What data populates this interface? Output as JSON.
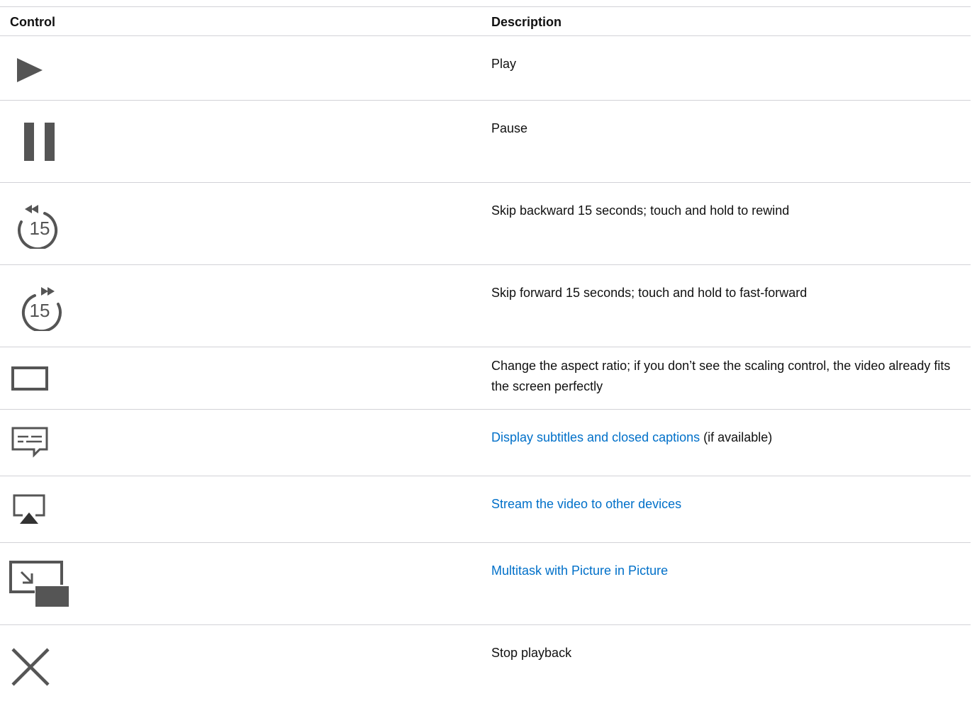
{
  "header": {
    "control": "Control",
    "description": "Description"
  },
  "rows": [
    {
      "icon": "play-icon",
      "description": "Play"
    },
    {
      "icon": "pause-icon",
      "description": "Pause"
    },
    {
      "icon": "skip-backward-15-icon",
      "icon_text": "15",
      "description": "Skip backward 15 seconds; touch and hold to rewind"
    },
    {
      "icon": "skip-forward-15-icon",
      "icon_text": "15",
      "description": "Skip forward 15 seconds; touch and hold to fast-forward"
    },
    {
      "icon": "aspect-ratio-icon",
      "description": "Change the aspect ratio; if you don’t see the scaling control, the video already fits the screen perfectly"
    },
    {
      "icon": "subtitles-icon",
      "link": "Display subtitles and closed captions",
      "description_suffix": " (if available)"
    },
    {
      "icon": "airplay-icon",
      "link": "Stream the video to other devices"
    },
    {
      "icon": "picture-in-picture-icon",
      "link": "Multitask with Picture in Picture"
    },
    {
      "icon": "close-icon",
      "description": "Stop playback"
    }
  ],
  "colors": {
    "icon": "#555555",
    "link": "#0070c9",
    "divider": "#d2d2d7"
  }
}
